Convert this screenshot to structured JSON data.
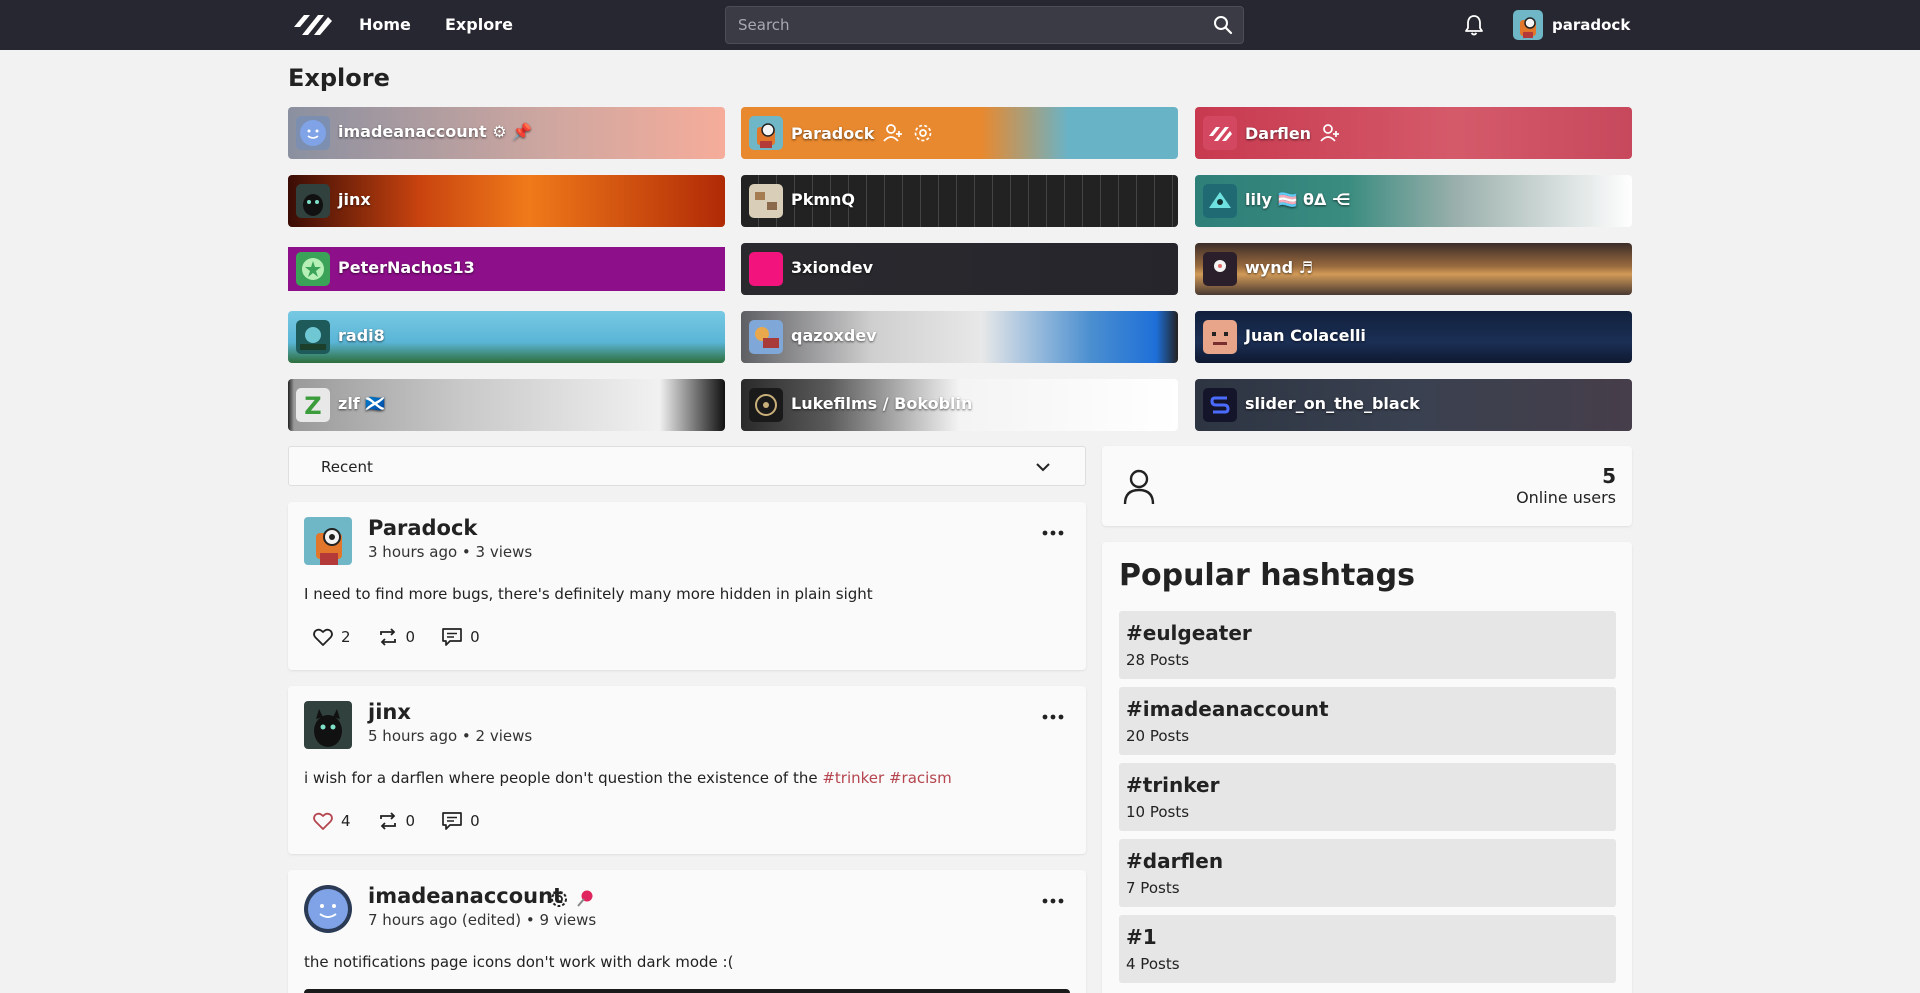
{
  "nav": {
    "home_label": "Home",
    "explore_label": "Explore",
    "search_placeholder": "Search",
    "username": "paradock"
  },
  "page_title": "Explore",
  "users": [
    {
      "name": "imadeanaccount ⚙ 📌"
    },
    {
      "name": "Paradock"
    },
    {
      "name": "Darflen"
    },
    {
      "name": "jinx"
    },
    {
      "name": "PkmnQ"
    },
    {
      "name": "lily 🏳️‍⚧️ θΔ ⋲"
    },
    {
      "name": "PeterNachos13"
    },
    {
      "name": "3xiondev"
    },
    {
      "name": "wynd ♬"
    },
    {
      "name": "radi8"
    },
    {
      "name": "qazoxdev"
    },
    {
      "name": "Juan Colacelli"
    },
    {
      "name": "zlf 🏴󠁧󠁢󠁳󠁣󠁴󠁿"
    },
    {
      "name": "Lukefilms / Bokoblin"
    },
    {
      "name": "slider_on_the_black"
    }
  ],
  "sort": {
    "selected": "Recent"
  },
  "posts": [
    {
      "author": "Paradock",
      "meta": "3 hours ago • 3 views",
      "text": "I need to find more bugs, there's definitely many more hidden in plain sight",
      "likes": "2",
      "reposts": "0",
      "comments": "0"
    },
    {
      "author": "jinx",
      "meta": "5 hours ago • 2 views",
      "text": "i wish for a darflen where people don't question the existence of the",
      "tag1": "#trinker",
      "tag2": "#racism",
      "likes": "4",
      "reposts": "0",
      "comments": "0"
    },
    {
      "author": "imadeanaccount",
      "meta": "7 hours ago (edited) • 9 views",
      "text": "the notifications page icons don't work with dark mode :("
    }
  ],
  "online": {
    "count": "5",
    "label": "Online users"
  },
  "hashtags": {
    "title": "Popular hashtags",
    "items": [
      {
        "tag": "#eulgeater",
        "count": "28 Posts"
      },
      {
        "tag": "#imadeanaccount",
        "count": "20 Posts"
      },
      {
        "tag": "#trinker",
        "count": "10 Posts"
      },
      {
        "tag": "#darflen",
        "count": "7 Posts"
      },
      {
        "tag": "#1",
        "count": "4 Posts"
      }
    ]
  },
  "colors": {
    "topbar": "#262730",
    "hashtag_link": "#b5454f",
    "liked_heart": "#b5454f"
  }
}
